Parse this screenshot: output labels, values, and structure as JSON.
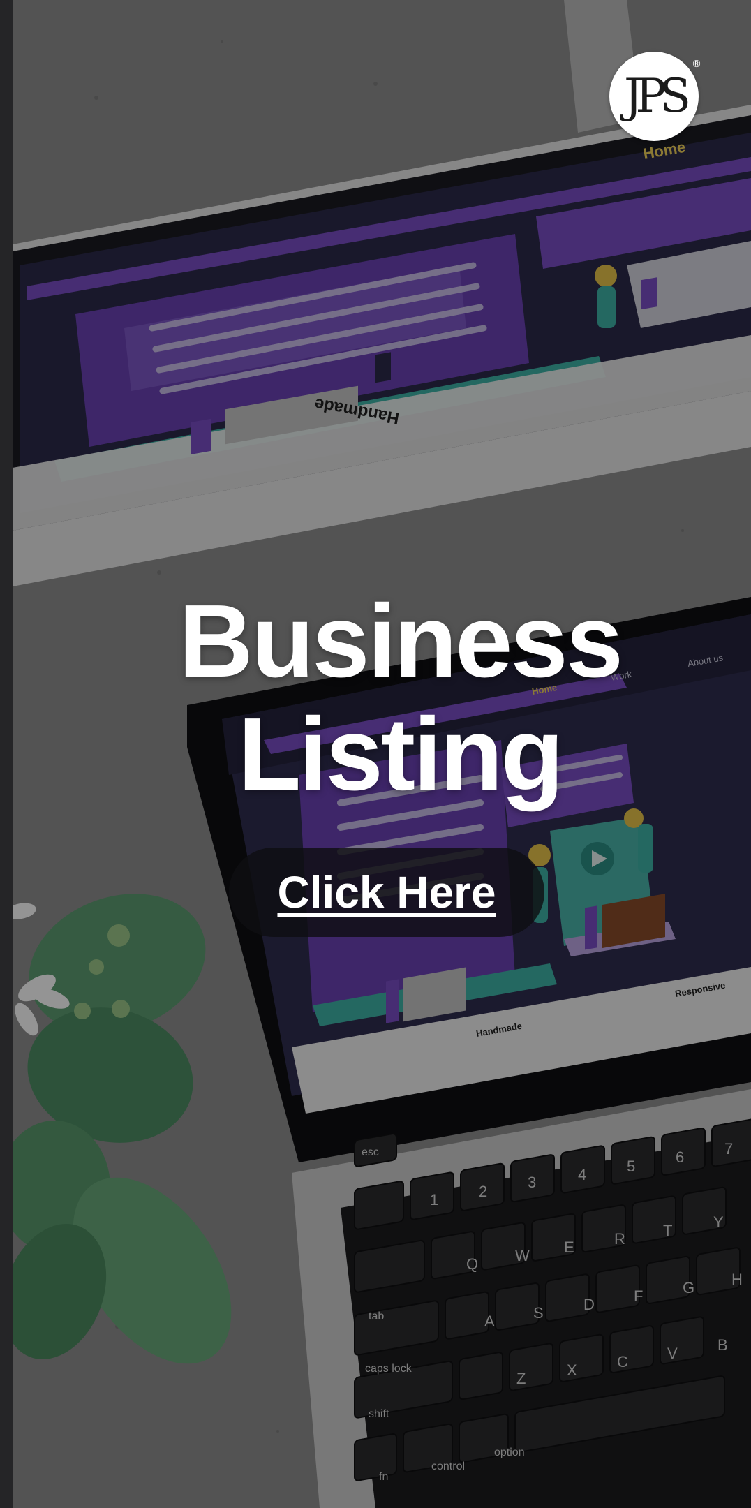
{
  "logo": {
    "text": "JPS",
    "registered": "®"
  },
  "hero": {
    "title_line1": "Business",
    "title_line2": "Listing",
    "cta_label": "Click Here"
  },
  "monitor": {
    "nav_home": "Home",
    "section_handmade": "Handmade"
  },
  "laptop": {
    "nav_home": "Home",
    "nav_work": "Work",
    "nav_about": "About us",
    "section_handmade": "Handmade",
    "section_responsive": "Responsive",
    "keys": {
      "esc": "esc",
      "tab": "tab",
      "caps": "caps lock",
      "shift": "shift",
      "fn": "fn",
      "control": "control",
      "option": "option",
      "q": "Q",
      "w": "W",
      "e": "E",
      "r": "R",
      "t": "T",
      "y": "Y",
      "a": "A",
      "s": "S",
      "d": "D",
      "f": "F",
      "g": "G",
      "h": "H",
      "z": "Z",
      "x": "X",
      "c": "C",
      "v": "V",
      "b": "B",
      "n1": "1",
      "n2": "2",
      "n3": "3",
      "n4": "4",
      "n5": "5",
      "n6": "6",
      "n7": "7"
    }
  },
  "colors": {
    "accent_purple": "#7b4fc7",
    "accent_teal": "#3fb3a8",
    "nav_yellow": "#f2d35a",
    "overlay": "#000000"
  }
}
